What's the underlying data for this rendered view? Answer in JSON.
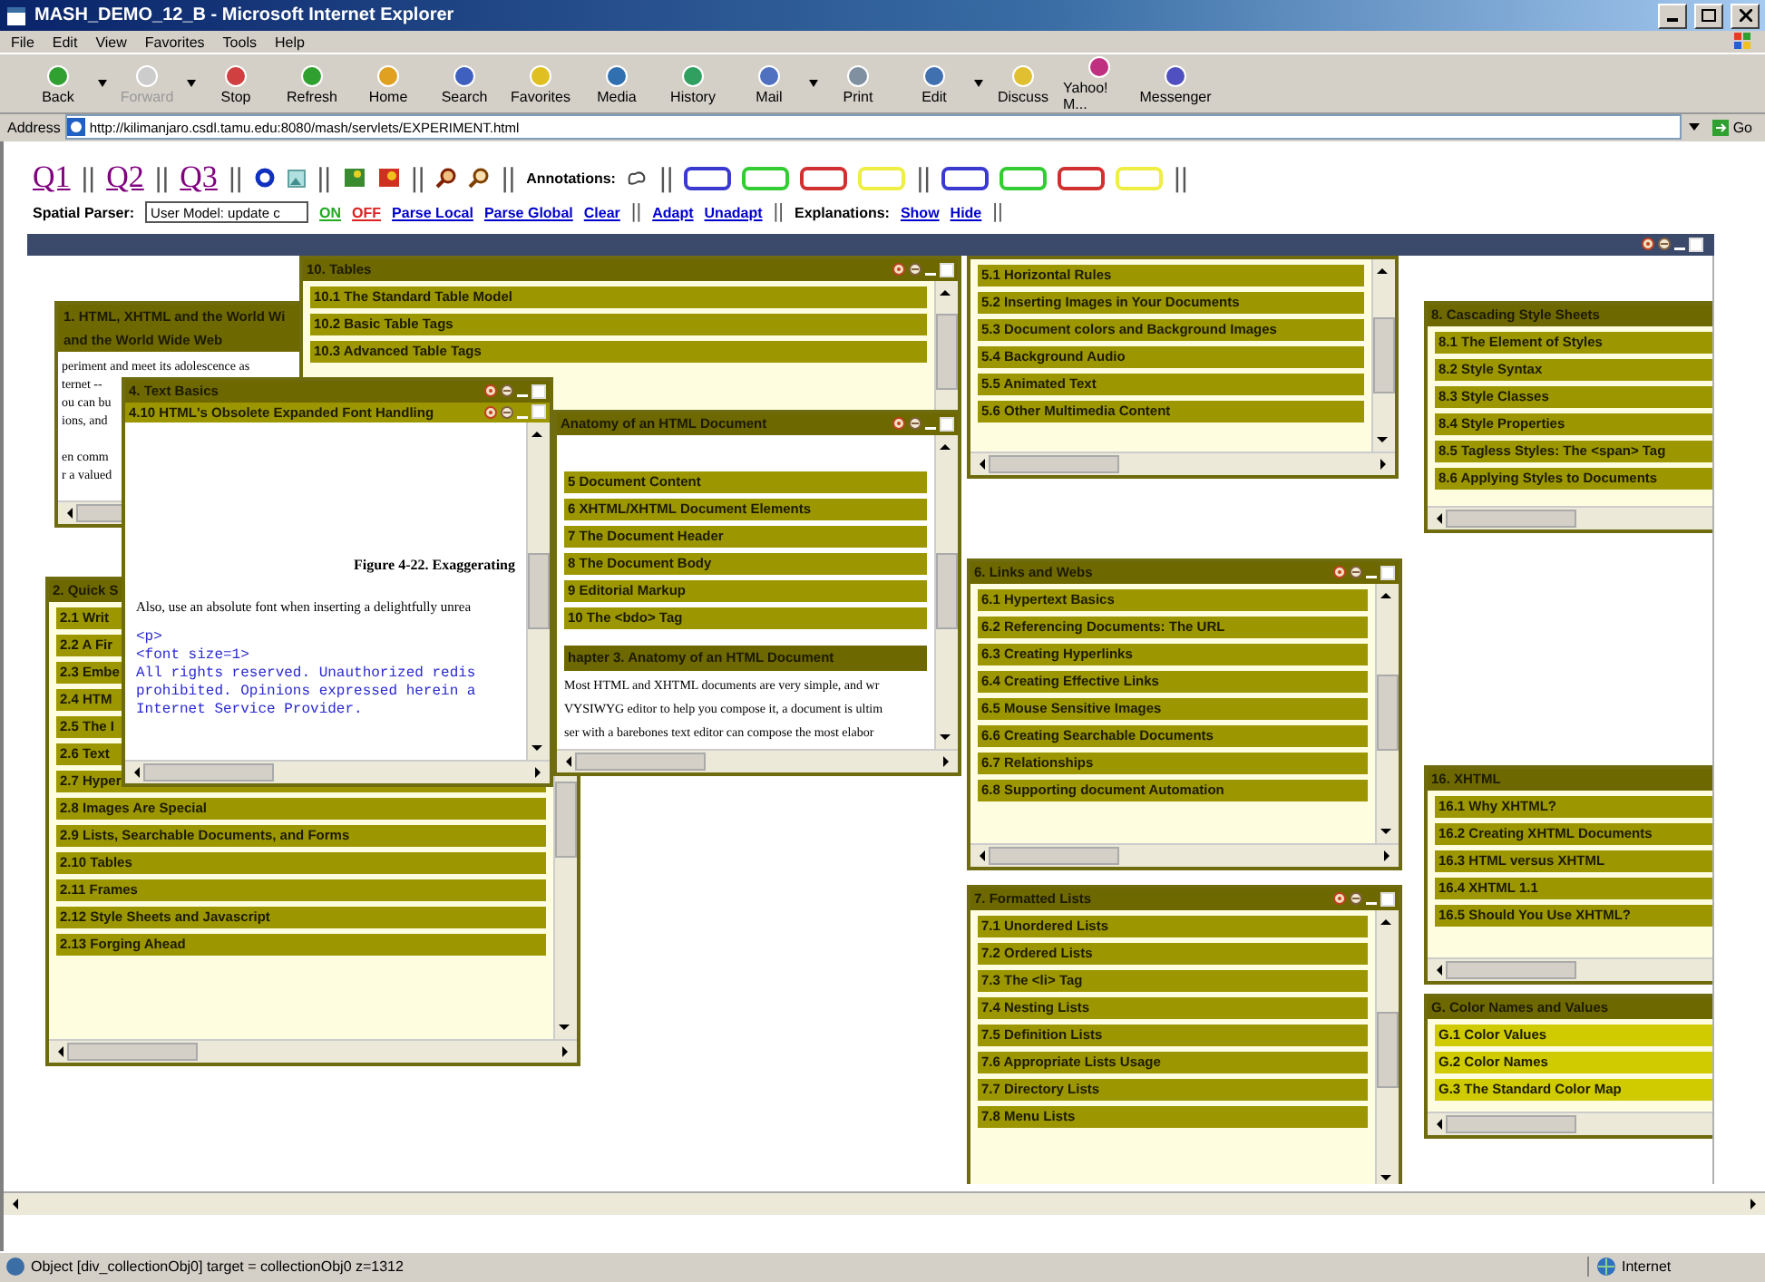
{
  "window": {
    "title": "MASH_DEMO_12_B - Microsoft Internet Explorer"
  },
  "menu": [
    {
      "label": "File"
    },
    {
      "label": "Edit"
    },
    {
      "label": "View"
    },
    {
      "label": "Favorites"
    },
    {
      "label": "Tools"
    },
    {
      "label": "Help"
    }
  ],
  "toolbar": [
    {
      "label": "Back",
      "disabled": false,
      "has_menu": true
    },
    {
      "label": "Forward",
      "disabled": true,
      "has_menu": true
    },
    {
      "label": "Stop",
      "disabled": false,
      "has_menu": false
    },
    {
      "label": "Refresh",
      "disabled": false,
      "has_menu": false
    },
    {
      "label": "Home",
      "disabled": false,
      "has_menu": false
    },
    {
      "label": "Search",
      "disabled": false,
      "has_menu": false
    },
    {
      "label": "Favorites",
      "disabled": false,
      "has_menu": false
    },
    {
      "label": "Media",
      "disabled": false,
      "has_menu": false
    },
    {
      "label": "History",
      "disabled": false,
      "has_menu": false
    },
    {
      "label": "Mail",
      "disabled": false,
      "has_menu": true
    },
    {
      "label": "Print",
      "disabled": false,
      "has_menu": false
    },
    {
      "label": "Edit",
      "disabled": false,
      "has_menu": true
    },
    {
      "label": "Discuss",
      "disabled": false,
      "has_menu": false
    },
    {
      "label": "Yahoo! M...",
      "disabled": false,
      "has_menu": false
    },
    {
      "label": "Messenger",
      "disabled": false,
      "has_menu": false
    }
  ],
  "address": {
    "label": "Address",
    "url": "http://kilimanjaro.csdl.tamu.edu:8080/mash/servlets/EXPERIMENT.html",
    "go": "Go"
  },
  "controls_row": [
    {
      "kind": "link",
      "text": "Q1"
    },
    {
      "kind": "sep",
      "text": "||"
    },
    {
      "kind": "link",
      "text": "Q2"
    },
    {
      "kind": "sep",
      "text": "||"
    },
    {
      "kind": "link",
      "text": "Q3"
    },
    {
      "kind": "sep",
      "text": "||"
    },
    {
      "kind": "icon"
    },
    {
      "kind": "icon"
    },
    {
      "kind": "sep",
      "text": "||"
    },
    {
      "kind": "icon"
    },
    {
      "kind": "icon"
    },
    {
      "kind": "sep",
      "text": "||"
    },
    {
      "kind": "icon"
    },
    {
      "kind": "icon"
    },
    {
      "kind": "sep",
      "text": "||"
    },
    {
      "kind": "label",
      "text": "Annotations:"
    },
    {
      "kind": "icon"
    },
    {
      "kind": "sep",
      "text": "||"
    },
    {
      "kind": "swatch",
      "color": "#3a3ad0"
    },
    {
      "kind": "swatch",
      "color": "#33cc33"
    },
    {
      "kind": "swatch",
      "color": "#d03030"
    },
    {
      "kind": "swatch",
      "color": "#eeee44"
    },
    {
      "kind": "sep",
      "text": "||"
    },
    {
      "kind": "swatch",
      "color": "#3a3ad0"
    },
    {
      "kind": "swatch",
      "color": "#33cc33"
    },
    {
      "kind": "swatch",
      "color": "#d03030"
    },
    {
      "kind": "swatch",
      "color": "#eeee44"
    },
    {
      "kind": "sep",
      "text": "||"
    }
  ],
  "parser_row": [
    {
      "kind": "label",
      "text": "Spatial Parser:"
    },
    {
      "kind": "input",
      "value": "User Model: update c"
    },
    {
      "kind": "link",
      "text": "ON",
      "color": "#22aa22"
    },
    {
      "kind": "link",
      "text": "OFF",
      "color": "#dd2222"
    },
    {
      "kind": "link",
      "text": "Parse Local"
    },
    {
      "kind": "link",
      "text": "Parse Global"
    },
    {
      "kind": "link",
      "text": "Clear"
    },
    {
      "kind": "sep",
      "text": "||"
    },
    {
      "kind": "link",
      "text": "Adapt"
    },
    {
      "kind": "link",
      "text": "Unadapt"
    },
    {
      "kind": "sep",
      "text": "||"
    },
    {
      "kind": "label",
      "text": "Explanations:"
    },
    {
      "kind": "link",
      "text": "Show"
    },
    {
      "kind": "link",
      "text": "Hide"
    },
    {
      "kind": "sep",
      "text": "||"
    }
  ],
  "panels": [
    {
      "kind": "text",
      "title_lines": [
        "1. HTML, XHTML and the World Wi",
        "and the World Wide Web"
      ],
      "body_lines": [
        "periment and meet its adolescence as",
        "ternet --",
        "ou can bu",
        "ions, and",
        "en comm",
        "r a valued"
      ]
    },
    {
      "kind": "list",
      "title": "10. Tables",
      "items": [
        {
          "label": "10.1 The Standard Table Model"
        },
        {
          "label": "10.2 Basic Table Tags"
        },
        {
          "label": "10.3 Advanced Table Tags"
        }
      ],
      "controls": true,
      "highlighted": false
    },
    {
      "kind": "list",
      "title": "2. Quick S",
      "items": [
        {
          "label": "2.1 Writ"
        },
        {
          "label": "2.2 A Fir"
        },
        {
          "label": "2.3 Embe"
        },
        {
          "label": "2.4 HTM"
        },
        {
          "label": "2.5 The I"
        },
        {
          "label": "2.6 Text"
        },
        {
          "label": "2.7 Hyper"
        },
        {
          "label": "2.8 Images Are Special"
        },
        {
          "label": "2.9 Lists, Searchable Documents, and Forms"
        },
        {
          "label": "2.10 Tables"
        },
        {
          "label": "2.11 Frames"
        },
        {
          "label": "2.12 Style Sheets and Javascript"
        },
        {
          "label": "2.13 Forging Ahead"
        }
      ],
      "highlighted": false
    },
    {
      "kind": "mixed",
      "title": "Anatomy of an HTML Document",
      "items": [
        {
          "label": "5 Document Content"
        },
        {
          "label": "6 XHTML/XHTML Document Elements"
        },
        {
          "label": "7 The Document Header"
        },
        {
          "label": "8 The Document Body"
        },
        {
          "label": "9 Editorial Markup"
        },
        {
          "label": "10 The <bdo> Tag"
        }
      ],
      "heading": "hapter 3. Anatomy of an HTML Document",
      "body_lines": [
        "Most HTML and XHTML documents are very simple, and wr",
        "VYSIWYG editor to help you compose it, a document is ultim",
        "ser with a barebones text editor can compose the most elabor"
      ],
      "controls": true,
      "highlighted": false
    },
    {
      "kind": "document",
      "title": "4. Text Basics",
      "subtitle": "4.10 HTML's Obsolete Expanded Font Handling",
      "caption": "Figure 4-22. Exaggerating",
      "paragraph": "Also, use an absolute font when inserting a delightfully unrea",
      "code_lines": [
        "<p>",
        "<font size=1>",
        "All rights reserved. Unauthorized redis",
        "prohibited. Opinions expressed herein a",
        "Internet Service Provider."
      ],
      "controls": true
    },
    {
      "kind": "list",
      "items": [
        {
          "label": "5.1 Horizontal Rules"
        },
        {
          "label": "5.2 Inserting Images in Your Documents"
        },
        {
          "label": "5.3 Document colors and Background Images"
        },
        {
          "label": "5.4 Background Audio"
        },
        {
          "label": "5.5 Animated Text"
        },
        {
          "label": "5.6 Other Multimedia Content"
        }
      ],
      "highlighted": false
    },
    {
      "kind": "list",
      "title": "6. Links and Webs",
      "items": [
        {
          "label": "6.1 Hypertext Basics"
        },
        {
          "label": "6.2 Referencing Documents: The URL"
        },
        {
          "label": "6.3 Creating Hyperlinks"
        },
        {
          "label": "6.4 Creating Effective Links"
        },
        {
          "label": "6.5 Mouse Sensitive Images"
        },
        {
          "label": "6.6 Creating Searchable Documents"
        },
        {
          "label": "6.7 Relationships"
        },
        {
          "label": "6.8 Supporting document Automation"
        }
      ],
      "controls": true,
      "highlighted": false
    },
    {
      "kind": "list",
      "title": "7. Formatted Lists",
      "items": [
        {
          "label": "7.1 Unordered Lists"
        },
        {
          "label": "7.2 Ordered Lists"
        },
        {
          "label": "7.3 The <li> Tag"
        },
        {
          "label": "7.4 Nesting Lists"
        },
        {
          "label": "7.5 Definition Lists"
        },
        {
          "label": "7.6 Appropriate Lists Usage"
        },
        {
          "label": "7.7 Directory Lists"
        },
        {
          "label": "7.8 Menu Lists"
        }
      ],
      "controls": true,
      "highlighted": false
    },
    {
      "kind": "list",
      "title": "8. Cascading Style Sheets",
      "items": [
        {
          "label": "8.1 The Element of Styles"
        },
        {
          "label": "8.2 Style Syntax"
        },
        {
          "label": "8.3 Style Classes"
        },
        {
          "label": "8.4 Style Properties"
        },
        {
          "label": "8.5 Tagless Styles: The <span> Tag"
        },
        {
          "label": "8.6 Applying Styles to Documents"
        }
      ],
      "highlighted": false
    },
    {
      "kind": "list",
      "title": "16. XHTML",
      "items": [
        {
          "label": "16.1 Why XHTML?"
        },
        {
          "label": "16.2 Creating XHTML Documents"
        },
        {
          "label": "16.3 HTML versus XHTML"
        },
        {
          "label": "16.4 XHTML 1.1"
        },
        {
          "label": "16.5 Should You Use XHTML?"
        }
      ],
      "highlighted": false
    },
    {
      "kind": "list",
      "title": "G. Color Names and Values",
      "items": [
        {
          "label": "G.1 Color Values"
        },
        {
          "label": "G.2 Color Names"
        },
        {
          "label": "G.3 The Standard Color Map"
        }
      ],
      "highlighted": true
    }
  ],
  "status_bar": {
    "text": "Object [div_collectionObj0] target = collectionObj0 z=1312",
    "zone": "Internet"
  }
}
